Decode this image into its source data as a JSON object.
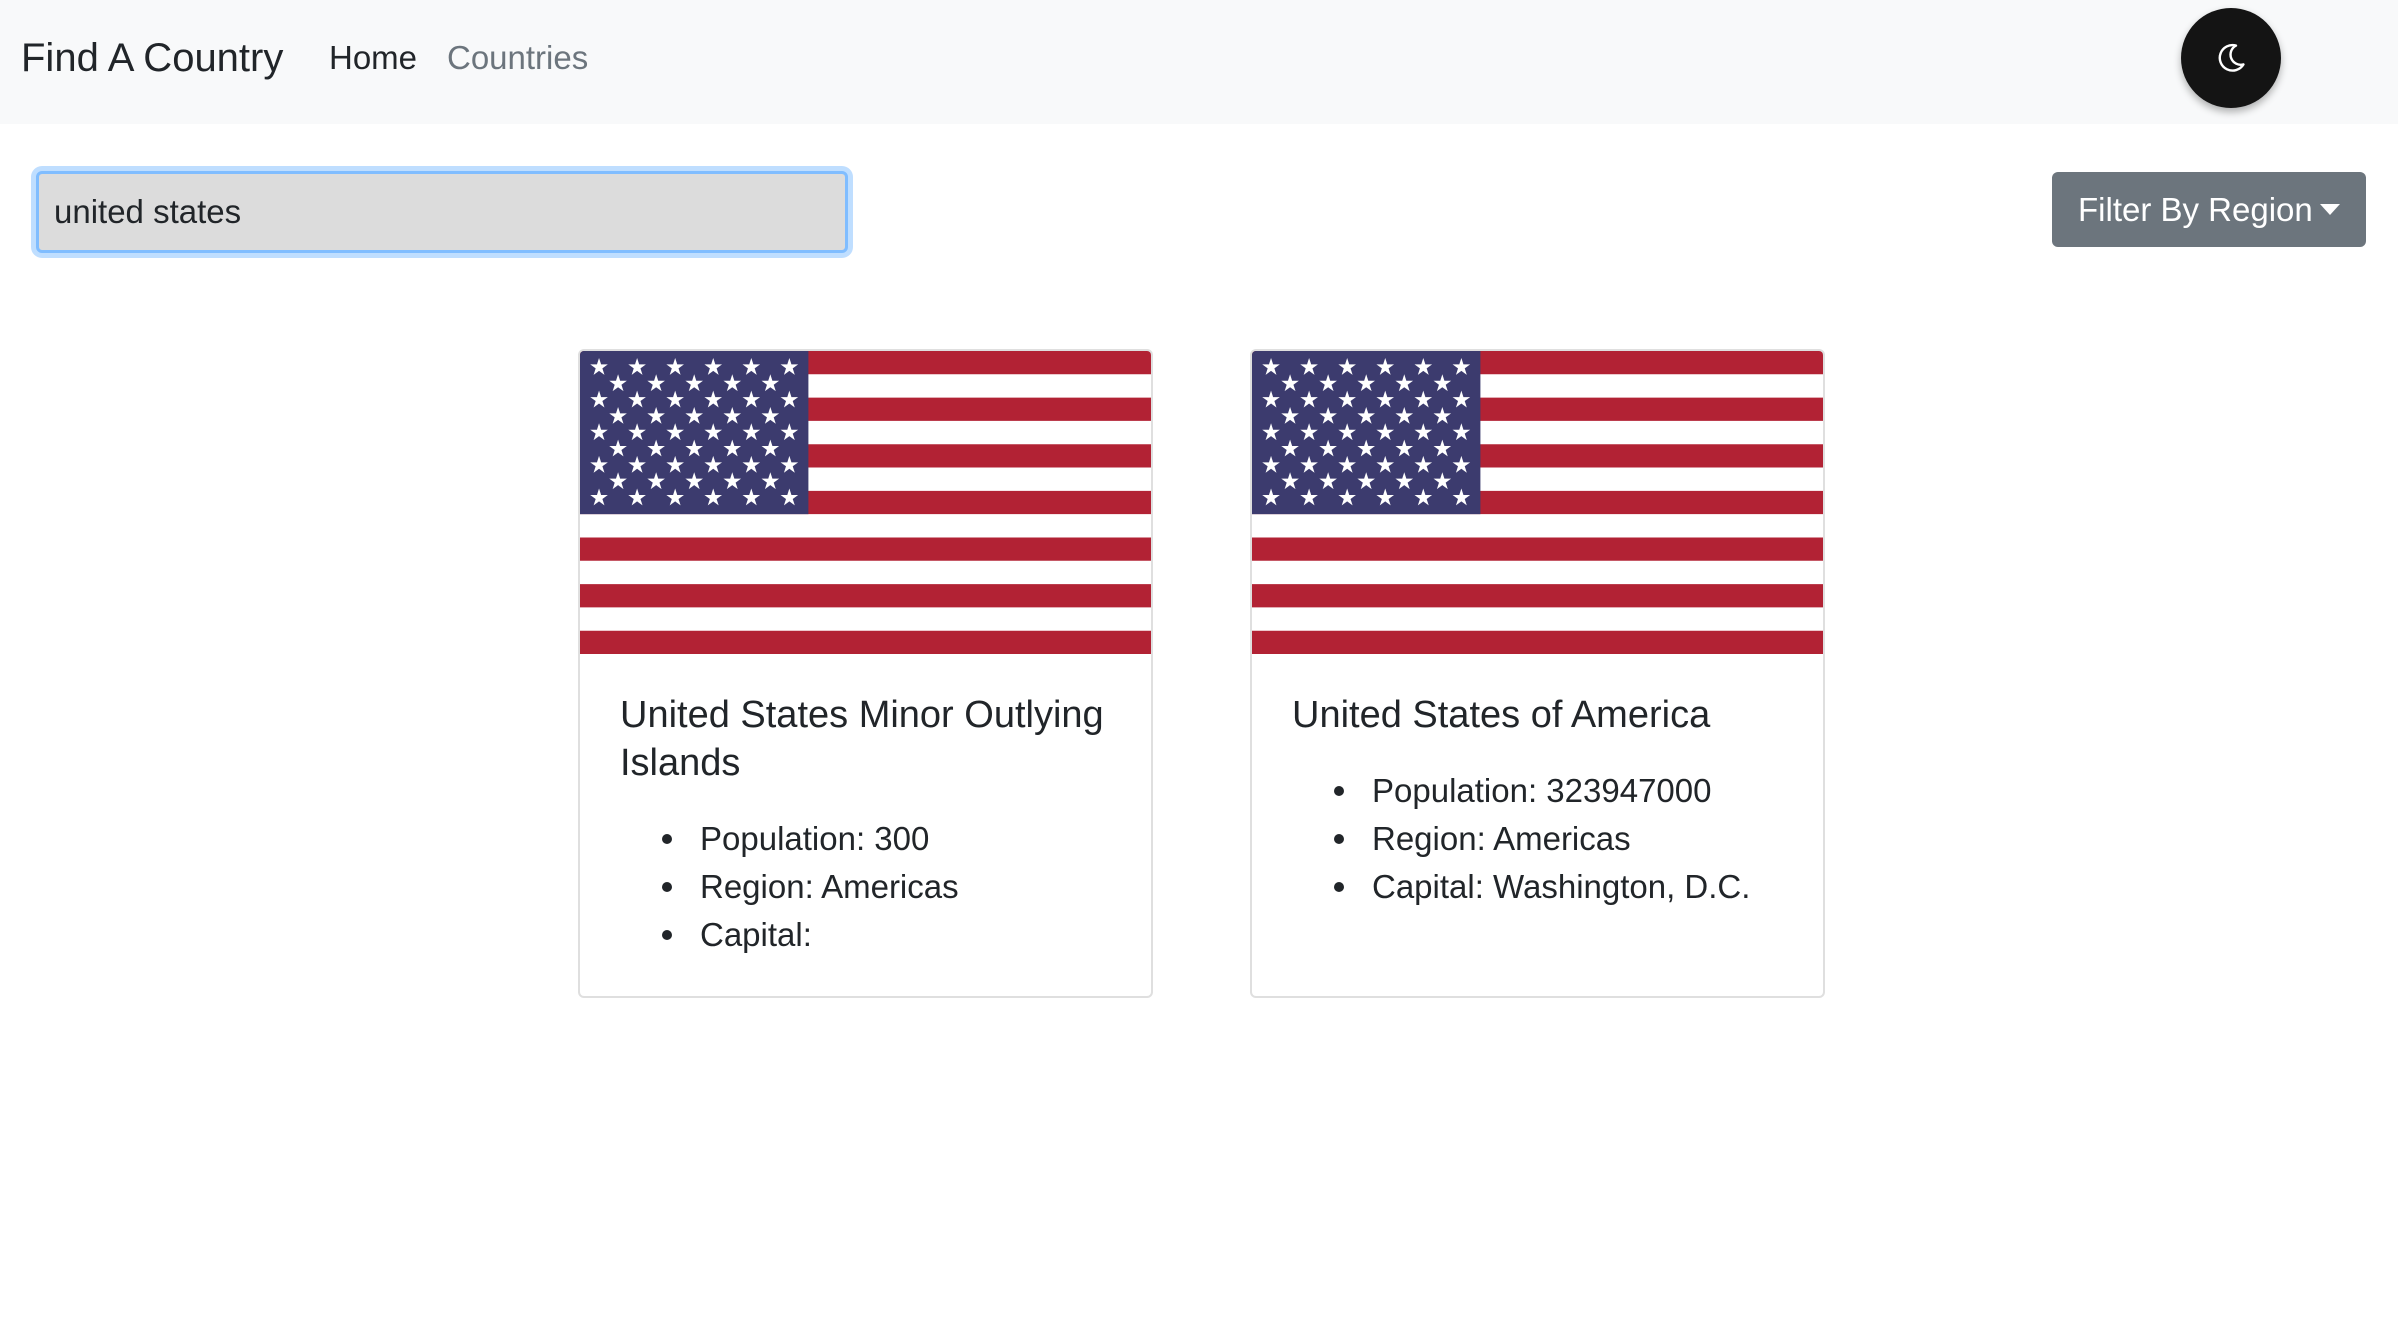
{
  "navbar": {
    "brand": "Find A Country",
    "links": [
      {
        "label": "Home",
        "active": true
      },
      {
        "label": "Countries",
        "active": false
      }
    ],
    "theme_toggle_icon": "moon-icon"
  },
  "search": {
    "value": "united states",
    "placeholder": ""
  },
  "filter": {
    "label": "Filter By Region",
    "icon": "caret-down-icon"
  },
  "cards": [
    {
      "name": "United States Minor Outlying Islands",
      "flag_icon": "us-flag",
      "population": "Population: 300",
      "region": "Region: Americas",
      "capital": "Capital:"
    },
    {
      "name": "United States of America",
      "flag_icon": "us-flag",
      "population": "Population: 323947000",
      "region": "Region: Americas",
      "capital": "Capital: Washington, D.C."
    }
  ],
  "colors": {
    "navbar_bg": "#f8f9fa",
    "button_secondary": "#6c757d",
    "flag_red": "#b22234",
    "flag_blue": "#3c3b6e",
    "focus_ring": "#80bdff"
  }
}
